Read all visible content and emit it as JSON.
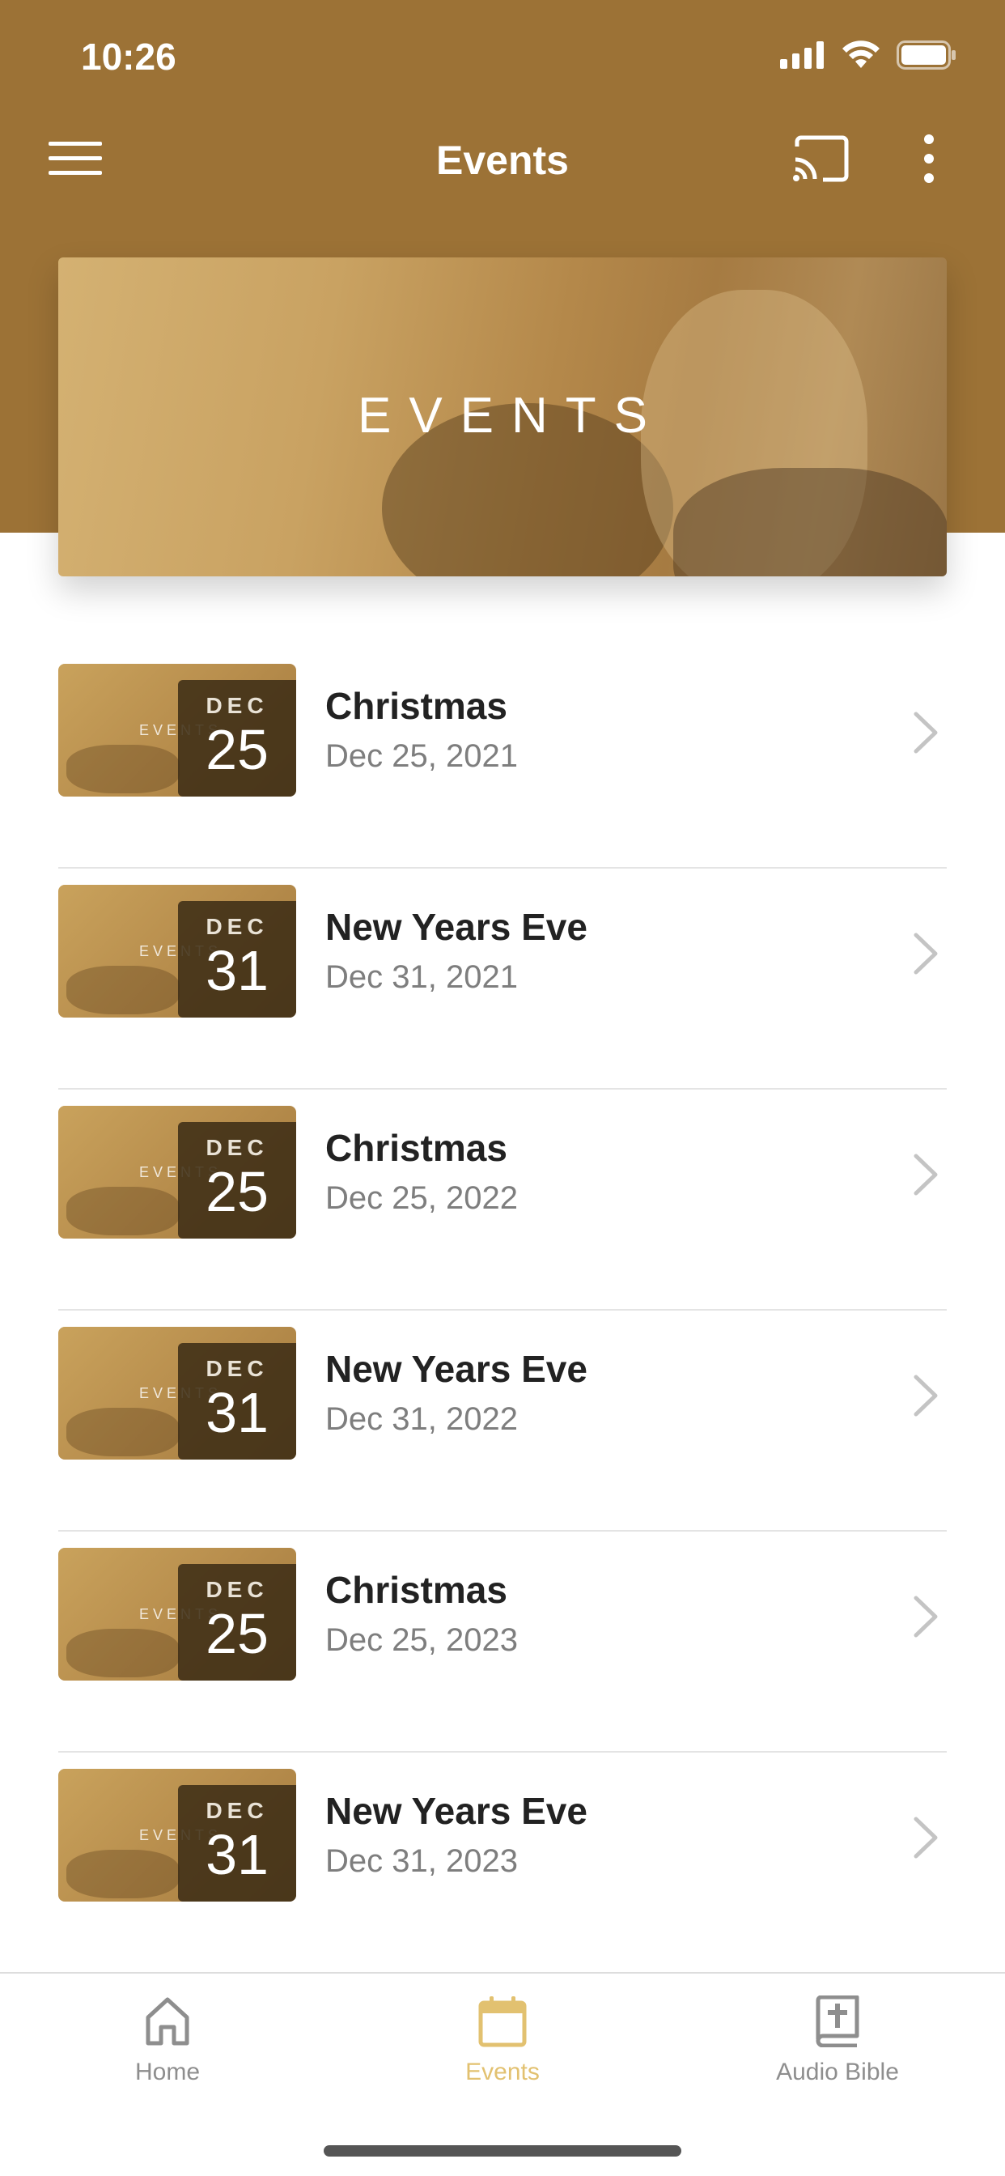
{
  "status_bar": {
    "time": "10:26"
  },
  "nav": {
    "title": "Events"
  },
  "banner": {
    "title": "EVENTS"
  },
  "events": [
    {
      "month": "DEC",
      "day": "25",
      "title": "Christmas",
      "date": "Dec 25, 2021"
    },
    {
      "month": "DEC",
      "day": "31",
      "title": "New Years Eve",
      "date": "Dec 31, 2021"
    },
    {
      "month": "DEC",
      "day": "25",
      "title": "Christmas",
      "date": "Dec 25, 2022"
    },
    {
      "month": "DEC",
      "day": "31",
      "title": "New Years Eve",
      "date": "Dec 31, 2022"
    },
    {
      "month": "DEC",
      "day": "25",
      "title": "Christmas",
      "date": "Dec 25, 2023"
    },
    {
      "month": "DEC",
      "day": "31",
      "title": "New Years Eve",
      "date": "Dec 31, 2023"
    }
  ],
  "thumbnail_watermark": "EVENTS",
  "tabs": [
    {
      "label": "Home",
      "icon": "home-icon"
    },
    {
      "label": "Events",
      "icon": "calendar-icon"
    },
    {
      "label": "Audio Bible",
      "icon": "bible-icon"
    }
  ],
  "colors": {
    "header": "#9c7236",
    "accent": "#e2c170",
    "tab_inactive": "#8e8e8e"
  }
}
